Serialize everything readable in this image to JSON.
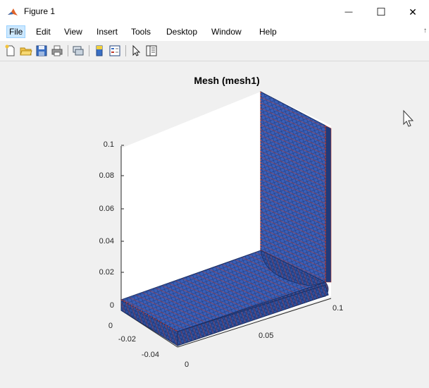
{
  "window": {
    "title": "Figure 1",
    "minimize_glyph": "—",
    "maximize_glyph": "☐",
    "close_glyph": "✕"
  },
  "menu": {
    "items": [
      {
        "label": "File",
        "name": "menu-file"
      },
      {
        "label": "Edit",
        "name": "menu-edit"
      },
      {
        "label": "View",
        "name": "menu-view"
      },
      {
        "label": "Insert",
        "name": "menu-insert"
      },
      {
        "label": "Tools",
        "name": "menu-tools"
      },
      {
        "label": "Desktop",
        "name": "menu-desktop"
      },
      {
        "label": "Window",
        "name": "menu-window"
      },
      {
        "label": "Help",
        "name": "menu-help"
      }
    ],
    "overflow_glyph": "↑"
  },
  "toolbar": {
    "icons": [
      "new-figure-icon",
      "open-file-icon",
      "save-icon",
      "print-icon",
      "link-plot-icon",
      "colorbar-icon",
      "legend-icon",
      "pointer-icon",
      "property-inspector-icon"
    ]
  },
  "plot": {
    "title": "Mesh (mesh1)",
    "z_ticks": [
      "0",
      "0.02",
      "0.04",
      "0.06",
      "0.08",
      "0.1"
    ],
    "x_ticks": [
      "0",
      "0.05",
      "0.1"
    ],
    "y_ticks": [
      "-0.04",
      "-0.02",
      "0"
    ],
    "colors": {
      "face": "#3a5fb8",
      "face_dark": "#2f4f9e",
      "face_light": "#4a72c8",
      "edge": "#c0392b",
      "axis": "#262626",
      "background": "#ffffff"
    }
  }
}
